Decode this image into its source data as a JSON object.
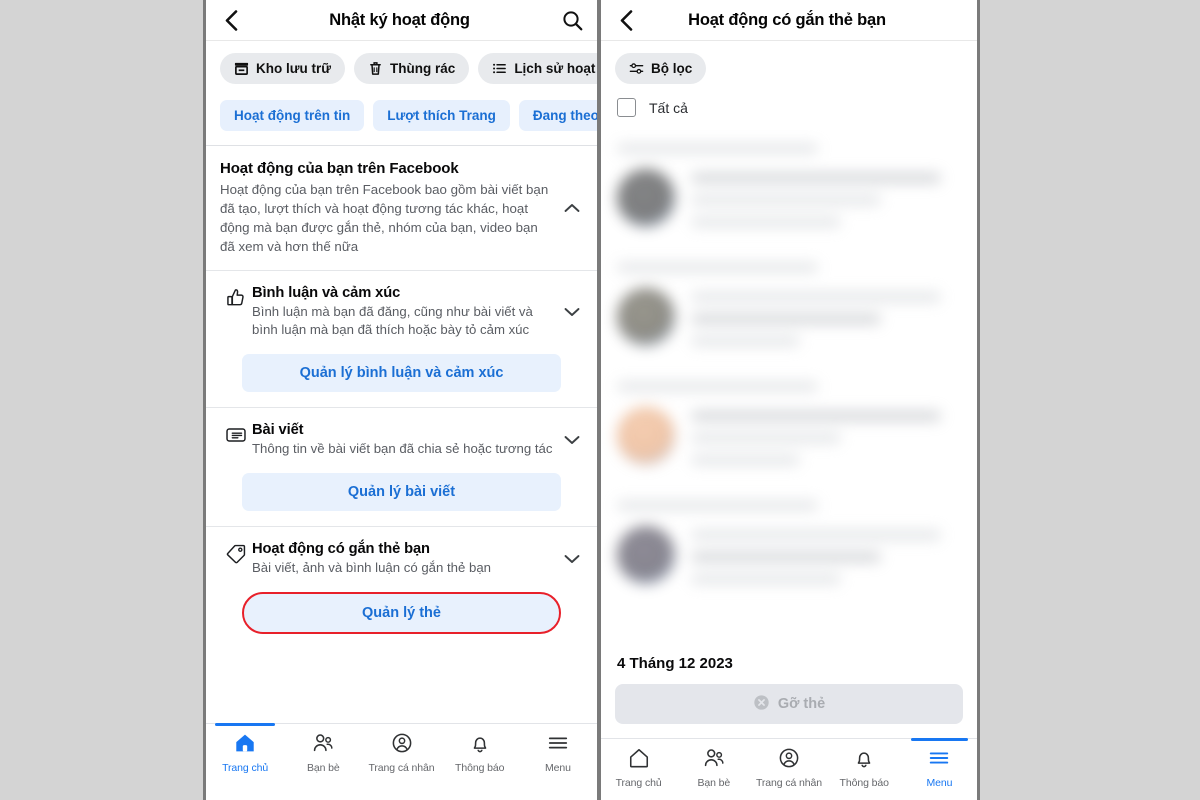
{
  "left_panel": {
    "header": {
      "back_icon": "back-chevron-icon",
      "title": "Nhật ký hoạt động",
      "search_icon": "search-icon"
    },
    "gray_chips": [
      {
        "label": "Kho lưu trữ",
        "icon": "archive-box-icon"
      },
      {
        "label": "Thùng rác",
        "icon": "trash-icon"
      },
      {
        "label": "Lịch sử hoạt động",
        "icon": "list-icon"
      }
    ],
    "blue_chips": [
      {
        "label": "Hoạt động trên tin"
      },
      {
        "label": "Lượt thích Trang"
      },
      {
        "label": "Đang theo d"
      }
    ],
    "intro": {
      "title": "Hoạt động của bạn trên Facebook",
      "description": "Hoạt động của bạn trên Facebook bao gồm bài viết bạn đã tạo, lượt thích và hoạt động tương tác khác, hoạt động mà bạn được gắn thẻ, nhóm của bạn, video bạn đã xem và hơn thế nữa",
      "caret": "chevron-up-icon"
    },
    "sections": [
      {
        "icon": "thumbs-up-icon",
        "title": "Bình luận và cảm xúc",
        "description": "Bình luận mà bạn đã đăng, cũng như bài viết và bình luận mà bạn đã thích hoặc bày tỏ cảm xúc",
        "caret": "chevron-down-icon",
        "action_label": "Quản lý bình luận và cảm xúc",
        "highlighted": false
      },
      {
        "icon": "post-icon",
        "title": "Bài viết",
        "description": "Thông tin về bài viết bạn đã chia sẻ hoặc tương tác",
        "caret": "chevron-down-icon",
        "action_label": "Quản lý bài viết",
        "highlighted": false
      },
      {
        "icon": "tag-icon",
        "title": "Hoạt động có gắn thẻ bạn",
        "description": "Bài viết, ảnh và bình luận có gắn thẻ bạn",
        "caret": "chevron-down-icon",
        "action_label": "Quản lý thẻ",
        "highlighted": true
      }
    ],
    "bottom_nav": {
      "active": "Trang chủ",
      "items": [
        {
          "label": "Trang chủ",
          "icon": "home-icon"
        },
        {
          "label": "Bạn bè",
          "icon": "friends-icon"
        },
        {
          "label": "Trang cá nhân",
          "icon": "profile-icon"
        },
        {
          "label": "Thông báo",
          "icon": "bell-icon"
        },
        {
          "label": "Menu",
          "icon": "hamburger-menu-icon"
        }
      ]
    }
  },
  "right_panel": {
    "header": {
      "back_icon": "back-chevron-icon",
      "title": "Hoạt động có gắn thẻ bạn"
    },
    "filter_button": {
      "label": "Bộ lọc",
      "icon": "filter-sliders-icon"
    },
    "select_all": {
      "label": "Tất cả",
      "checked": false
    },
    "blurred_entries": 4,
    "date_label": "4 Tháng 12 2023",
    "remove_button": {
      "label": "Gỡ thẻ",
      "icon": "remove-circle-icon",
      "disabled": true
    },
    "bottom_nav": {
      "active": "Menu",
      "items": [
        {
          "label": "Trang chủ",
          "icon": "home-icon"
        },
        {
          "label": "Bạn bè",
          "icon": "friends-icon"
        },
        {
          "label": "Trang cá nhân",
          "icon": "profile-icon"
        },
        {
          "label": "Thông báo",
          "icon": "bell-icon"
        },
        {
          "label": "Menu",
          "icon": "hamburger-menu-icon"
        }
      ]
    }
  },
  "colors": {
    "accent_blue": "#1877f2",
    "link_blue": "#1b6fd4",
    "chip_blue_bg": "#e7f0fd",
    "chip_gray_bg": "#e8eaed",
    "highlight_red": "#e8202a",
    "page_bg": "#d4d4d4"
  }
}
